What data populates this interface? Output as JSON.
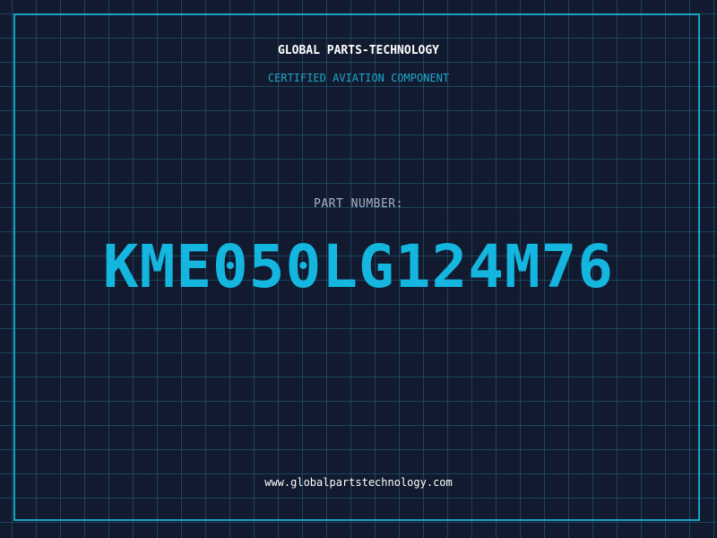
{
  "brand": {
    "name": "GLOBAL PARTS-TECHNOLOGY",
    "tagline": "CERTIFIED AVIATION COMPONENT"
  },
  "part": {
    "label": "PART NUMBER:",
    "number": "KME050LG124M76"
  },
  "footer": {
    "website": "www.globalpartstechnology.com"
  },
  "colors": {
    "background": "#111a2e",
    "grid": "#287896",
    "frame": "#1aa3c4",
    "accent": "#14b6e0",
    "label": "#a7b3c6",
    "text": "#ffffff"
  }
}
